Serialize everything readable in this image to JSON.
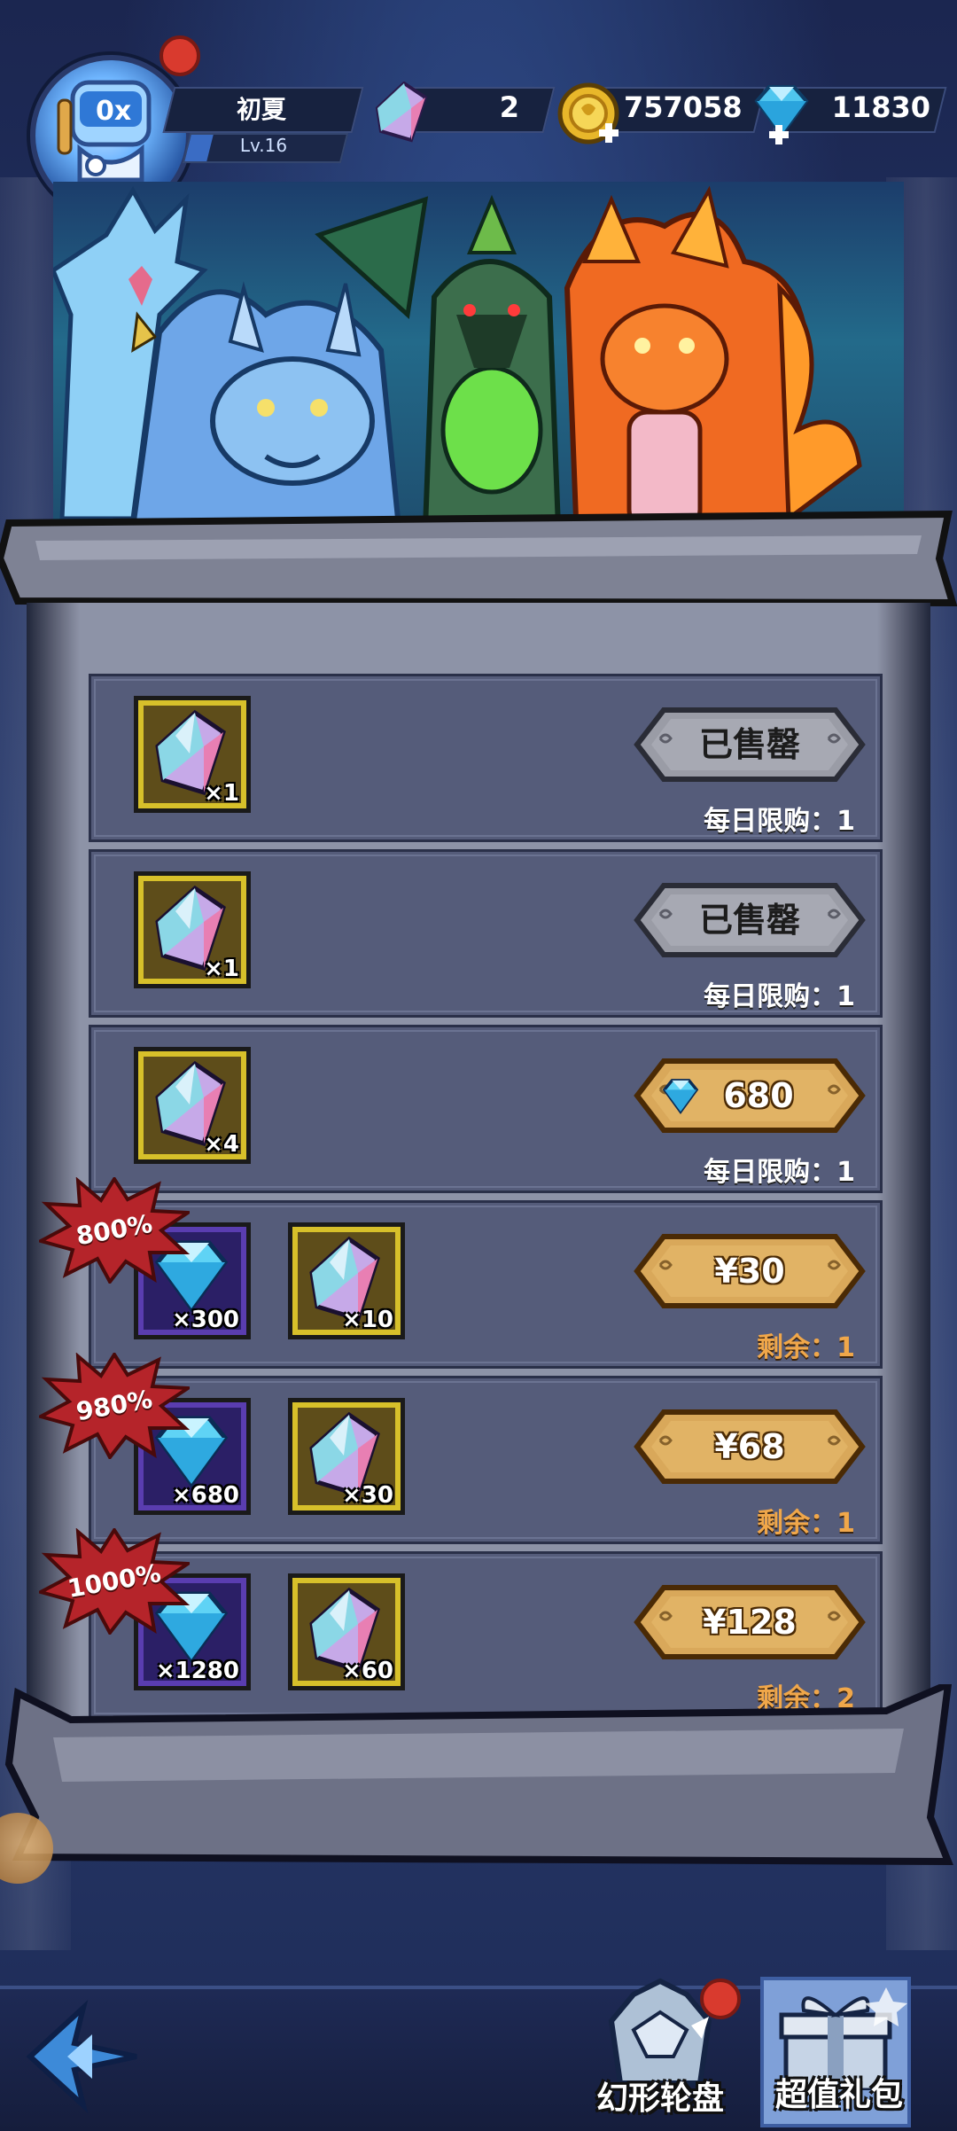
{
  "player": {
    "name": "初夏",
    "level": "Lv.16",
    "level_progress": 0.14
  },
  "resources": {
    "crystal": {
      "icon": "crystal-icon",
      "value": "2"
    },
    "gold": {
      "icon": "gold-coin-plus-icon",
      "value": "757058"
    },
    "diamond": {
      "icon": "diamond-plus-icon",
      "value": "11830"
    }
  },
  "shop": {
    "rows": [
      {
        "items": [
          {
            "icon": "crystal-icon",
            "qty": "×1"
          }
        ],
        "button": "已售罄",
        "button_type": "sold_out",
        "limit": "每日限购：1"
      },
      {
        "items": [
          {
            "icon": "crystal-icon",
            "qty": "×1"
          }
        ],
        "button": "已售罄",
        "button_type": "sold_out",
        "limit": "每日限购：1"
      },
      {
        "items": [
          {
            "icon": "crystal-icon",
            "qty": "×4"
          }
        ],
        "button": "680",
        "button_type": "diamond",
        "limit": "每日限购：1"
      },
      {
        "badge": "800%",
        "items": [
          {
            "icon": "diamond-icon",
            "qty": "×300"
          },
          {
            "icon": "crystal-icon",
            "qty": "×10"
          }
        ],
        "button": "¥30",
        "button_type": "cash",
        "limit": "剩余：1"
      },
      {
        "badge": "980%",
        "items": [
          {
            "icon": "diamond-icon",
            "qty": "×680"
          },
          {
            "icon": "crystal-icon",
            "qty": "×30"
          }
        ],
        "button": "¥68",
        "button_type": "cash",
        "limit": "剩余：1"
      },
      {
        "badge": "1000%",
        "items": [
          {
            "icon": "diamond-icon",
            "qty": "×1280"
          },
          {
            "icon": "crystal-icon",
            "qty": "×60"
          }
        ],
        "button": "¥128",
        "button_type": "cash",
        "limit": "剩余：2"
      }
    ]
  },
  "nav": {
    "wheel_label": "幻形轮盘",
    "gift_label": "超值礼包"
  },
  "colors": {
    "accent_gold": "#d9a85a",
    "sold_out_grey": "#9a9ca6",
    "badge_red": "#b5242a",
    "remain_orange": "#f0a74a"
  }
}
